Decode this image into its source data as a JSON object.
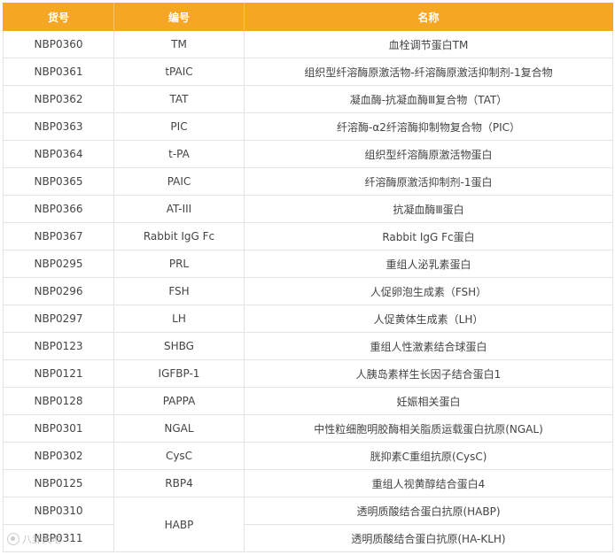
{
  "table": {
    "headers": [
      "货号",
      "编号",
      "名称"
    ],
    "rows": [
      {
        "code": "NBP0360",
        "abbr": "TM",
        "name": "血栓调节蛋白TM"
      },
      {
        "code": "NBP0361",
        "abbr": "tPAIC",
        "name": "组织型纤溶酶原激活物-纤溶酶原激活抑制剂-1复合物"
      },
      {
        "code": "NBP0362",
        "abbr": "TAT",
        "name": "凝血酶-抗凝血酶Ⅲ复合物（TAT）"
      },
      {
        "code": "NBP0363",
        "abbr": "PIC",
        "name": "纤溶酶-α2纤溶酶抑制物复合物（PIC）"
      },
      {
        "code": "NBP0364",
        "abbr": "t-PA",
        "name": "组织型纤溶酶原激活物蛋白"
      },
      {
        "code": "NBP0365",
        "abbr": "PAIC",
        "name": "纤溶酶原激活抑制剂-1蛋白"
      },
      {
        "code": "NBP0366",
        "abbr": "AT-III",
        "name": "抗凝血酶Ⅲ蛋白"
      },
      {
        "code": "NBP0367",
        "abbr": "Rabbit IgG Fc",
        "name": "Rabbit IgG Fc蛋白"
      },
      {
        "code": "NBP0295",
        "abbr": "PRL",
        "name": "重组人泌乳素蛋白"
      },
      {
        "code": "NBP0296",
        "abbr": "FSH",
        "name": "人促卵泡生成素（FSH）"
      },
      {
        "code": "NBP0297",
        "abbr": "LH",
        "name": "人促黄体生成素（LH）"
      },
      {
        "code": "NBP0123",
        "abbr": "SHBG",
        "name": "重组人性激素结合球蛋白"
      },
      {
        "code": "NBP0121",
        "abbr": "IGFBP-1",
        "name": "人胰岛素样生长因子结合蛋白1"
      },
      {
        "code": "NBP0128",
        "abbr": "PAPPA",
        "name": "妊娠相关蛋白"
      },
      {
        "code": "NBP0301",
        "abbr": "NGAL",
        "name": "中性粒细胞明胶酶相关脂质运载蛋白抗原(NGAL)"
      },
      {
        "code": "NBP0302",
        "abbr": "CysC",
        "name": "胱抑素C重组抗原(CysC)"
      },
      {
        "code": "NBP0125",
        "abbr": "RBP4",
        "name": "重组人视黄醇结合蛋白4"
      },
      {
        "code": "NBP0310",
        "abbr": "HABP",
        "name": "透明质酸结合蛋白抗原(HABP)"
      },
      {
        "code": "NBP0311",
        "abbr": "",
        "name": "透明质酸结合蛋白抗原(HA-KLH)"
      }
    ]
  },
  "watermark": {
    "text": "八卦天地",
    "icon": "watermark-logo-icon"
  },
  "colors": {
    "header_bg": "#f5a623",
    "header_text": "#ffffff",
    "body_text": "#444444",
    "border": "#e3e3e3"
  }
}
